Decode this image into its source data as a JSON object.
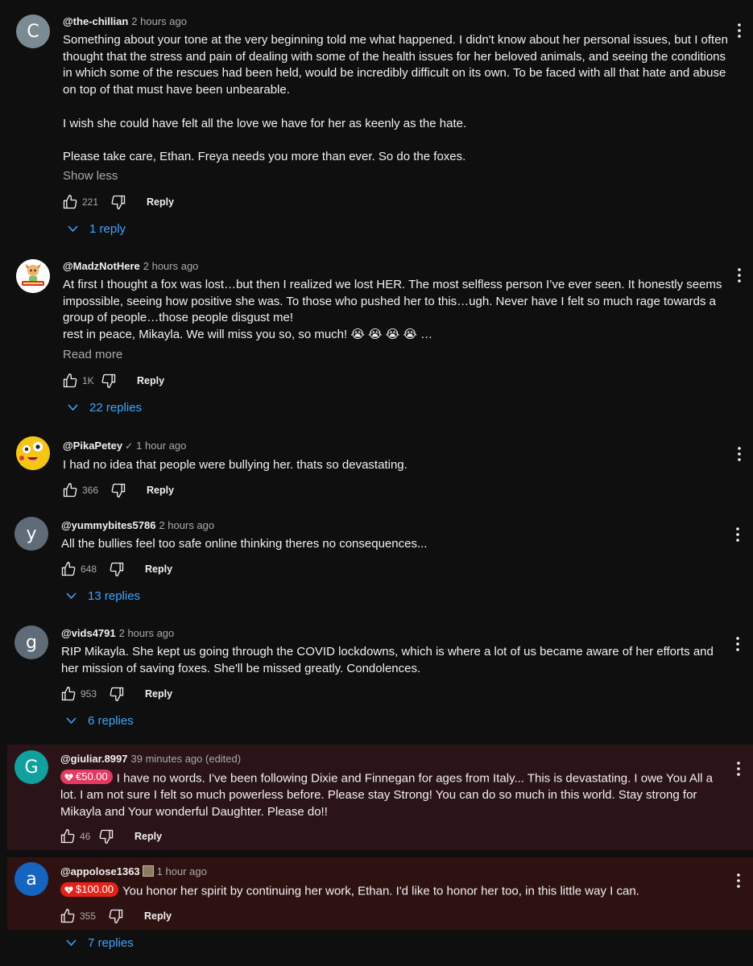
{
  "labels": {
    "reply": "Reply"
  },
  "colors": {
    "page_bg": "#0f0f0f",
    "link_blue": "#3ea6ff",
    "eur_badge": "#e23a62",
    "usd_badge": "#e62117",
    "eur_row_bg": "#2a1417",
    "usd_row_bg": "#2e1212"
  },
  "comments": [
    {
      "avatar_letter": "C",
      "avatar_color": "#7c8a93",
      "handle": "@the-chillian",
      "time": "2 hours ago",
      "paragraphs": [
        "Something about your tone at the very beginning told me what happened. I didn't know about her personal issues, but I often thought that the stress and pain of dealing with some of the health issues for her beloved animals, and seeing the conditions in which some of the rescues had been held, would be incredibly difficult on its own. To be faced with all that hate and abuse on top of that must have been unbearable.",
        "I wish she could have felt all the love we have for her as keenly as the hate.",
        "Please take care, Ethan. Freya needs you more than ever. So do the foxes."
      ],
      "toggle": "Show less",
      "likes": "221",
      "replies": "1 reply"
    },
    {
      "avatar_icon": "fox-cartoon-avatar-icon",
      "handle": "@MadzNotHere",
      "time": "2 hours ago",
      "lines": [
        "At first I thought a fox was lost…but then I realized we lost HER. The most selfless person I’ve ever seen. It honestly seems impossible, seeing how positive she was. To those who pushed her to this…ugh. Never have I felt so much rage towards a group of people…those people disgust me!",
        "rest in peace, Mikayla. We will miss you so, so much! 😭 😭 😭 😭 …"
      ],
      "toggle": "Read more",
      "likes": "1K",
      "replies": "22 replies"
    },
    {
      "avatar_icon": "pikachu-face-avatar-icon",
      "handle": "@PikaPetey",
      "verified": "✓",
      "time": "1 hour ago",
      "text": "I had no idea that people were bullying her.  thats so devastating.",
      "likes": "366"
    },
    {
      "avatar_letter": "y",
      "avatar_color": "#5f6b76",
      "handle": "@yummybites5786",
      "time": "2 hours ago",
      "text": "All the bullies feel too safe online thinking theres no consequences...",
      "likes": "648",
      "replies": "13 replies"
    },
    {
      "avatar_letter": "g",
      "avatar_color": "#5f6b76",
      "handle": "@vids4791",
      "time": "2 hours ago",
      "text": "RIP Mikayla. She kept us going through the COVID lockdowns, which is where a lot of us became aware of her efforts and her mission of saving foxes. She'll be missed greatly. Condolences.",
      "likes": "953",
      "replies": "6 replies"
    },
    {
      "avatar_letter": "G",
      "avatar_color": "#11a0a0",
      "handle": "@giuliar.8997",
      "time": "39 minutes ago (edited)",
      "super_amount": "€50.00",
      "text": "I have no words. I've been following Dixie and Finnegan for ages from Italy...  This is devastating.  I owe You All a lot. I am not sure I  felt so much powerless before. Please stay Strong! You can do so much in this world. Stay strong for Mikayla and Your wonderful Daughter. Please do!!",
      "likes": "46"
    },
    {
      "avatar_letter": "a",
      "avatar_color": "#1565c0",
      "handle": "@appolose1363",
      "time": "1 hour ago",
      "member_badge": "member-badge-icon",
      "super_amount": "$100.00",
      "text": "You honor her spirit by continuing her work, Ethan. I'd like to honor her too, in this little way I can.",
      "likes": "355",
      "replies": "7 replies"
    }
  ]
}
